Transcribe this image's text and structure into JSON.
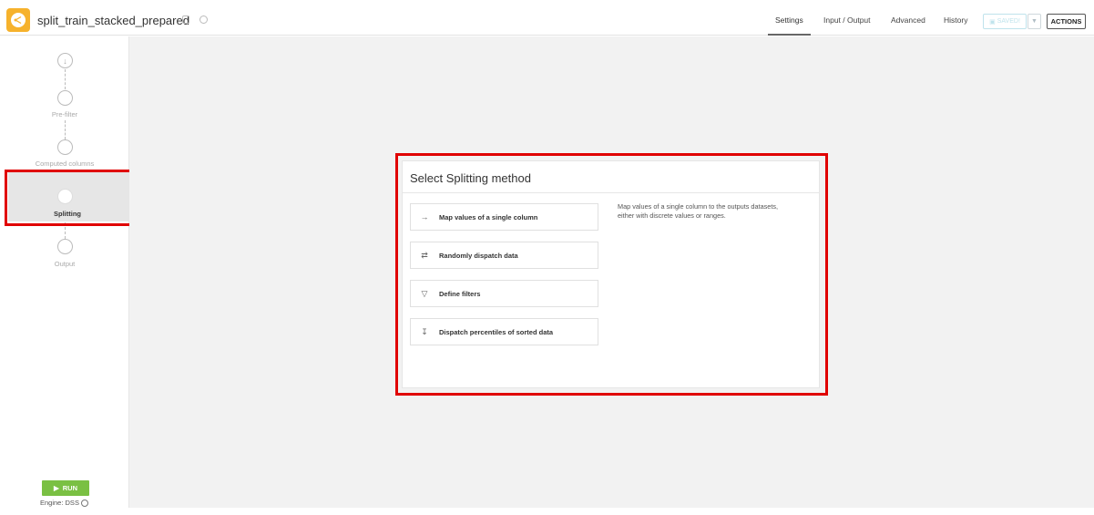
{
  "header": {
    "recipe_title": "split_train_stacked_prepared",
    "tabs": [
      {
        "label": "Settings",
        "active": true
      },
      {
        "label": "Input / Output",
        "active": false
      },
      {
        "label": "Advanced",
        "active": false
      },
      {
        "label": "History",
        "active": false
      }
    ],
    "saved_label": "SAVED!",
    "actions_label": "ACTIONS"
  },
  "sidebar": {
    "steps": [
      {
        "label": "Pre-filter"
      },
      {
        "label": "Computed columns"
      },
      {
        "label": "Splitting",
        "active": true
      },
      {
        "label": "Output"
      }
    ],
    "run_label": "RUN",
    "engine_label": "Engine: DSS"
  },
  "panel": {
    "title": "Select Splitting method",
    "methods": [
      {
        "label": "Map values of a single column",
        "icon": "map-values-icon"
      },
      {
        "label": "Randomly dispatch data",
        "icon": "shuffle-icon"
      },
      {
        "label": "Define filters",
        "icon": "filter-icon"
      },
      {
        "label": "Dispatch percentiles of sorted data",
        "icon": "sort-icon"
      }
    ],
    "description": "Map values of a single column to the outputs datasets, either with discrete values or ranges."
  },
  "colors": {
    "accent": "#f6b22c",
    "run_green": "#7ac043",
    "highlight_red": "#e00000"
  }
}
